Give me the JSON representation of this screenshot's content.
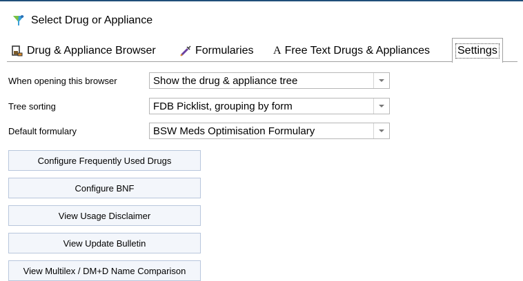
{
  "window": {
    "title": "Select Drug or Appliance",
    "icon": "funnel-icon"
  },
  "tabs": [
    {
      "label": "Drug & Appliance Browser",
      "icon": "flask-icon",
      "active": false
    },
    {
      "label": "Formularies",
      "icon": "syringe-icon",
      "active": false
    },
    {
      "label": "Free Text Drugs & Appliances",
      "icon": "letter-a-icon",
      "active": false
    },
    {
      "label": "Settings",
      "icon": "",
      "active": true
    }
  ],
  "settings": {
    "opening_label": "When opening this browser",
    "opening_value": "Show the drug & appliance tree",
    "sorting_label": "Tree sorting",
    "sorting_value": "FDB Picklist, grouping by form",
    "formulary_label": "Default formulary",
    "formulary_value": "BSW Meds Optimisation Formulary"
  },
  "buttons": {
    "frequent": "Configure Frequently Used Drugs",
    "bnf": "Configure BNF",
    "disclaimer": "View Usage Disclaimer",
    "bulletin": "View Update Bulletin",
    "comparison": "View Multilex / DM+D Name Comparison"
  },
  "colors": {
    "button_bg": "#f3f6fb",
    "button_border": "#b8c6dc",
    "accent": "#1f4e79"
  }
}
